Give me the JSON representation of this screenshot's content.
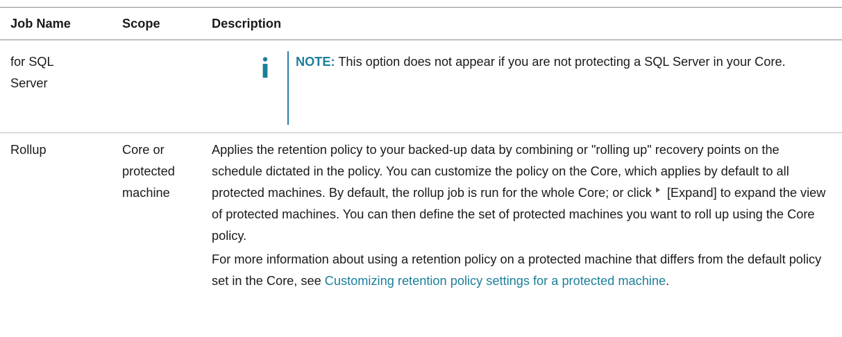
{
  "table": {
    "headers": {
      "job_name": "Job Name",
      "scope": "Scope",
      "description": "Description"
    },
    "row_1": {
      "job_name": "for SQL Server",
      "note_label": "NOTE:",
      "note_text": " This option does not appear if you are not protecting a SQL Server in your Core."
    },
    "row_2": {
      "job_name": "Rollup",
      "scope": "Core or protected machine",
      "para1_a": "Applies the retention policy to your backed-up data by combining or \"rolling up\" recovery points on the schedule dictated in the policy. You can customize the policy on the Core, which applies by default to all protected machines. By default, the rollup job is run for the whole Core; or click",
      "expand_icon": "expand-triangle-icon",
      "para1_b": "[Expand] to expand the view of protected machines. You can then define the set of protected machines you want to roll up using the Core policy.",
      "para2_a": "For more information about using a retention policy on a protected machine that differs from the default policy set in the Core, see ",
      "link_text": "Customizing retention policy settings for a protected machine",
      "para2_b": "."
    }
  },
  "colors": {
    "accent": "#1b7f9a",
    "note_bar": "#2a7ea8",
    "text": "#1a1a1a"
  }
}
